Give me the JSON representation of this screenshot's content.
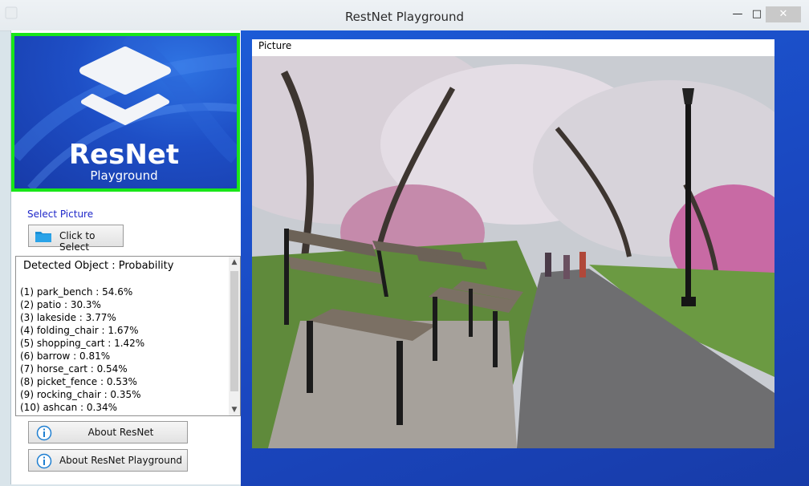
{
  "window": {
    "title": "RestNet Playground",
    "minimize_glyph": "—",
    "maximize_glyph": "□",
    "close_glyph": "✕"
  },
  "logo": {
    "title": "ResNet",
    "subtitle": "Playground",
    "border_color": "#19e619"
  },
  "select": {
    "label": "Select Picture",
    "button_label": "Click to Select",
    "button_icon": "folder-icon"
  },
  "results": {
    "header": "Detected Object : Probability",
    "items": [
      "(1) park_bench : 54.6%",
      "(2) patio : 30.3%",
      "(3) lakeside : 3.77%",
      "(4) folding_chair : 1.67%",
      "(5) shopping_cart : 1.42%",
      "(6) barrow : 0.81%",
      "(7) horse_cart : 0.54%",
      "(8) picket_fence : 0.53%",
      "(9) rocking_chair : 0.35%",
      "(10) ashcan : 0.34%"
    ]
  },
  "about": {
    "resnet_label": "About ResNet",
    "playground_label": "About ResNet Playground",
    "icon": "info-icon"
  },
  "picture": {
    "caption": "Picture"
  },
  "colors": {
    "accent_blue": "#1f27c9",
    "desktop_blue": "#1a47c0"
  }
}
